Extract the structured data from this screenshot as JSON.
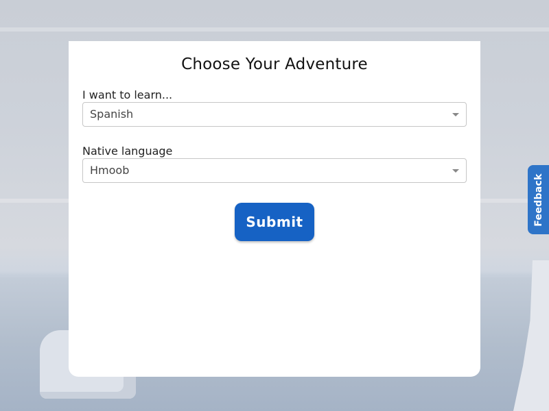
{
  "page": {
    "title": "Choose Your Adventure"
  },
  "form": {
    "learn_label": "I want to learn...",
    "learn_value": "Spanish",
    "native_label": "Native language",
    "native_value": "Hmoob",
    "submit_label": "Submit"
  },
  "feedback": {
    "label": "Feedback"
  },
  "colors": {
    "accent": "#1662c4",
    "feedback_tab": "#2e74c8"
  }
}
